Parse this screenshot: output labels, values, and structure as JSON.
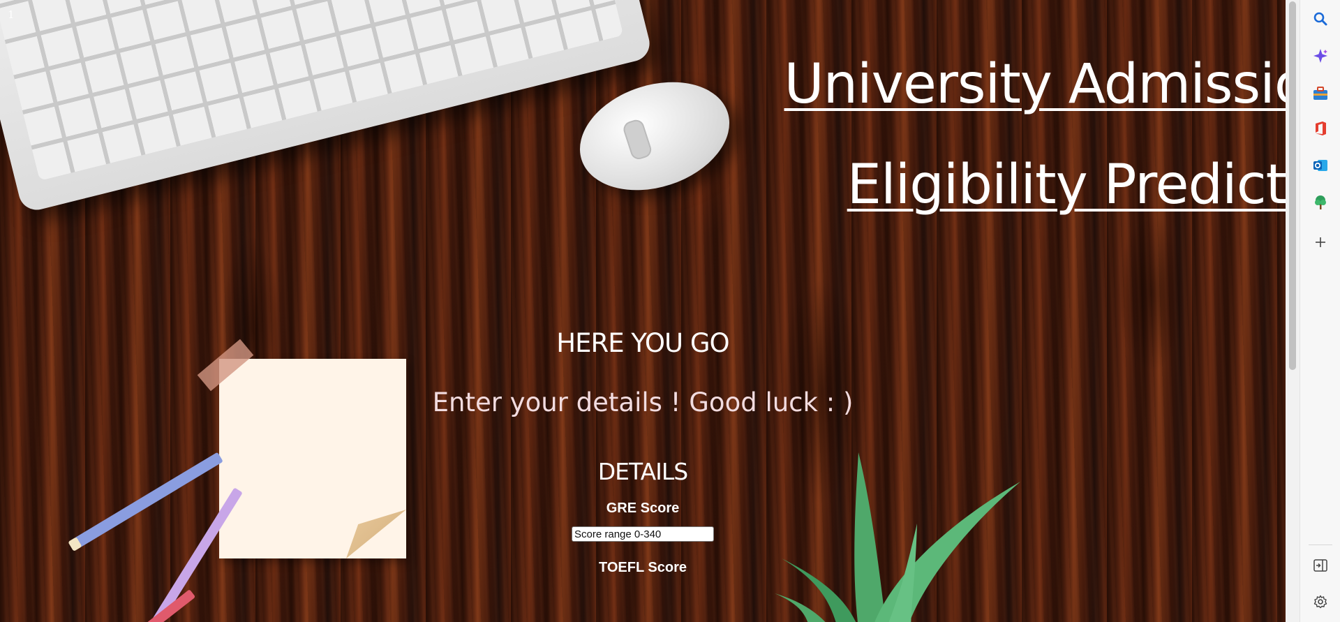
{
  "page": {
    "page_marker": "1",
    "title_line1": "University Admission",
    "title_line2": "Eligibility Predictor",
    "heading": "HERE YOU GO",
    "subheading": "Enter your details ! Good luck : )",
    "details_heading": "DETAILS"
  },
  "form": {
    "fields": [
      {
        "label": "GRE Score",
        "placeholder": "Score range 0-340"
      },
      {
        "label": "TOEFL Score"
      }
    ]
  },
  "colors": {
    "title_text": "#ffffff",
    "subheading_text": "#f2dce0",
    "sidebar_bg": "#f7f7f7"
  },
  "edge_sidebar": {
    "icons": [
      "search-icon",
      "copilot-sparkle-icon",
      "tools-briefcase-icon",
      "office-icon",
      "outlook-icon",
      "tree-icon",
      "add-icon",
      "sidebar-collapse-icon",
      "settings-gear-icon"
    ]
  }
}
